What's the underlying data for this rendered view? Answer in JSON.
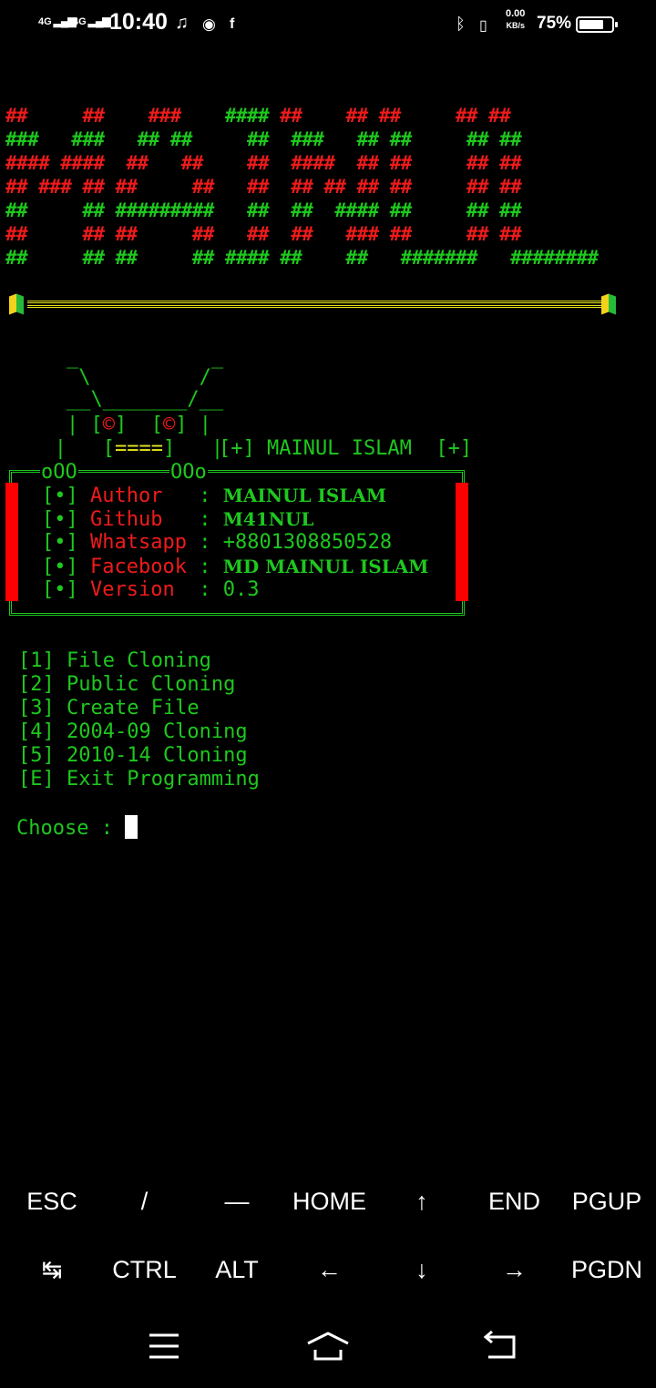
{
  "status_bar": {
    "signal_1": "4G",
    "signal_2": "4G",
    "time": "10:40",
    "net_speed_value": "0.00",
    "net_speed_unit": "KB/s",
    "battery_percent": "75%",
    "battery_level": 0.75,
    "icons": [
      "music-note-icon",
      "messenger-icon",
      "facebook-icon",
      "bluetooth-icon",
      "vibrate-icon"
    ]
  },
  "terminal": {
    "banner_lines": [
      [
        "##     ##    ###    #### ##    ## ##     ## ##",
        "rgrgrgrgrgr"
      ],
      [
        "###   ###   ## ##     ##  ###   ## ##     ## ##",
        "ggggggggggg"
      ],
      [
        "#### ####  ##   ##    ##  ####  ## ##     ## ##",
        "rrrrrrrrrrr"
      ],
      [
        "## ### ## ##     ##   ##  ## ## ## ##     ## ##",
        "rrrrrrrrrrr"
      ],
      [
        "##     ## #########   ##  ##  #### ##     ## ##",
        "ggggggggggg"
      ],
      [
        "##     ## ##     ##   ##  ##   ### ##     ## ##",
        "rrrrrrrrrrr"
      ],
      [
        "##     ## ##     ## #### ##    ##   #######   ########",
        "ggggggggggg"
      ]
    ],
    "ascii_logo": [
      "    _           _",
      "     \\         /",
      "    __\\_______/__",
      "    | [©]  [©] |",
      "   |   [====]   |"
    ],
    "tagline": "[+] MAINUL ISLAM  [+]",
    "box_cap_left": "oOO",
    "box_cap_right": "OOo",
    "info": [
      {
        "bullet": "[•]",
        "key": "Author   ",
        "sep": ":",
        "value": "MAINUL ISLAM"
      },
      {
        "bullet": "[•]",
        "key": "Github   ",
        "sep": ":",
        "value": "M41NUL"
      },
      {
        "bullet": "[•]",
        "key": "Whatsapp ",
        "sep": ":",
        "value": "+8801308850528"
      },
      {
        "bullet": "[•]",
        "key": "Facebook ",
        "sep": ":",
        "value": "MD MAINUL ISLAM"
      },
      {
        "bullet": "[•]",
        "key": "Version  ",
        "sep": ":",
        "value": "0.3"
      }
    ],
    "menu": [
      "[1] File Cloning",
      "[2] Public Cloning",
      "[3] Create File",
      "[4] 2004-09 Cloning",
      "[5] 2010-14 Cloning",
      "[E] Exit Programming"
    ],
    "prompt": "Choose : "
  },
  "extra_keys": {
    "row1": [
      "ESC",
      "/",
      "—",
      "HOME",
      "↑",
      "END",
      "PGUP"
    ],
    "row2": [
      "↹",
      "CTRL",
      "ALT",
      "←",
      "↓",
      "→",
      "PGDN"
    ]
  },
  "nav_bar": [
    "menu-icon",
    "home-icon",
    "back-icon"
  ]
}
